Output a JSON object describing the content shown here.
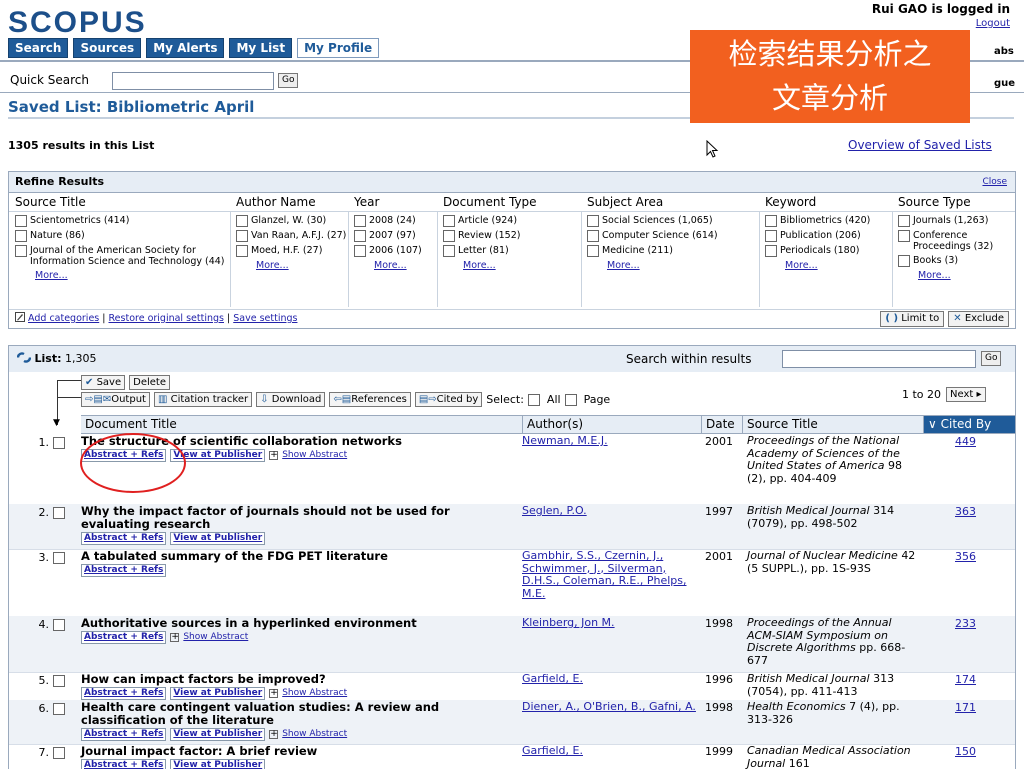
{
  "header": {
    "logo": "SCOPUS",
    "user": "Rui GAO is logged in",
    "logout": "Logout",
    "labs": "abs",
    "gue": "gue"
  },
  "nav": [
    "Search",
    "Sources",
    "My Alerts",
    "My List",
    "My Profile"
  ],
  "quick_search": {
    "label": "Quick Search",
    "value": "",
    "go": "Go"
  },
  "saved_list_title": "Saved List: Bibliometric April",
  "results_count": "1305 results in this List",
  "overview_link": "Overview of Saved Lists",
  "overlay": {
    "line1": "检索结果分析之",
    "line2": "文章分析"
  },
  "refine": {
    "title": "Refine Results",
    "close": "Close",
    "columns": [
      {
        "header": "Source Title",
        "items": [
          "Scientometrics (414)",
          "Nature (86)",
          "Journal of the American Society for Information Science and Technology (44)"
        ],
        "more": "More..."
      },
      {
        "header": "Author Name",
        "items": [
          "Glanzel, W. (30)",
          "Van Raan, A.F.J. (27)",
          "Moed, H.F. (27)"
        ],
        "more": "More..."
      },
      {
        "header": "Year",
        "items": [
          "2008 (24)",
          "2007 (97)",
          "2006 (107)"
        ],
        "more": "More..."
      },
      {
        "header": "Document Type",
        "items": [
          "Article (924)",
          "Review (152)",
          "Letter (81)"
        ],
        "more": "More..."
      },
      {
        "header": "Subject Area",
        "items": [
          "Social Sciences (1,065)",
          "Computer Science (614)",
          "Medicine (211)"
        ],
        "more": "More..."
      },
      {
        "header": "Keyword",
        "items": [
          "Bibliometrics (420)",
          "Publication (206)",
          "Periodicals (180)"
        ],
        "more": "More..."
      },
      {
        "header": "Source Type",
        "items": [
          "Journals (1,263)",
          "Conference Proceedings (32)",
          "Books (3)"
        ],
        "more": "More..."
      }
    ],
    "footer": {
      "add": "Add categories",
      "restore": "Restore original settings",
      "save": "Save settings",
      "limit": "Limit to",
      "exclude": "Exclude"
    }
  },
  "list": {
    "label": "List:",
    "count": "1,305",
    "search_within": "Search within results",
    "go": "Go",
    "save": "Save",
    "delete": "Delete",
    "output": "Output",
    "citation_tracker": "Citation tracker",
    "download": "Download",
    "references": "References",
    "cited_by": "Cited by",
    "select": "Select:",
    "all": "All",
    "page": "Page",
    "pager": "1 to 20",
    "next": "Next"
  },
  "columns": {
    "doc": "Document Title",
    "author": "Author(s)",
    "date": "Date",
    "source": "Source Title",
    "cited": "Cited By"
  },
  "rows": [
    {
      "num": "1.",
      "title": "The structure of scientific collaboration networks",
      "links": [
        "Abstract + Refs",
        "View at Publisher"
      ],
      "show_abstract": "Show Abstract",
      "authors": "Newman, M.E.J.",
      "date": "2001",
      "source": "Proceedings of the National Academy of Sciences of the United States of America",
      "pages": "98 (2), pp. 404-409",
      "cited": "449"
    },
    {
      "num": "2.",
      "title": "Why the impact factor of journals should not be used for evaluating research",
      "links": [
        "Abstract + Refs",
        "View at Publisher"
      ],
      "show_abstract": "",
      "authors": "Seglen, P.O.",
      "date": "1997",
      "source": "British Medical Journal",
      "pages": "314 (7079), pp. 498-502",
      "cited": "363"
    },
    {
      "num": "3.",
      "title": "A tabulated summary of the FDG PET literature",
      "links": [
        "Abstract + Refs"
      ],
      "show_abstract": "",
      "authors": "Gambhir, S.S., Czernin, J., Schwimmer, J., Silverman, D.H.S., Coleman, R.E., Phelps, M.E.",
      "date": "2001",
      "source": "Journal of Nuclear Medicine",
      "pages": "42 (5 SUPPL.), pp. 1S-93S",
      "cited": "356"
    },
    {
      "num": "4.",
      "title": "Authoritative sources in a hyperlinked environment",
      "links": [
        "Abstract + Refs"
      ],
      "show_abstract": "Show Abstract",
      "authors": "Kleinberg, Jon M.",
      "date": "1998",
      "source": "Proceedings of the Annual ACM-SIAM Symposium on Discrete Algorithms",
      "pages": "pp. 668-677",
      "cited": "233"
    },
    {
      "num": "5.",
      "title": "How can impact factors be improved?",
      "links": [
        "Abstract + Refs",
        "View at Publisher"
      ],
      "show_abstract": "Show Abstract",
      "authors": "Garfield, E.",
      "date": "1996",
      "source": "British Medical Journal",
      "pages": "313 (7054), pp. 411-413",
      "cited": "174"
    },
    {
      "num": "6.",
      "title": "Health care contingent valuation studies: A review and classification of the literature",
      "links": [
        "Abstract + Refs",
        "View at Publisher"
      ],
      "show_abstract": "Show Abstract",
      "authors": "Diener, A., O'Brien, B., Gafni, A.",
      "date": "1998",
      "source": "Health Economics",
      "pages": "7 (4), pp. 313-326",
      "cited": "171"
    },
    {
      "num": "7.",
      "title": "Journal impact factor: A brief review",
      "links": [
        "Abstract + Refs",
        "View at Publisher"
      ],
      "show_abstract": "",
      "authors": "Garfield, E.",
      "date": "1999",
      "source": "Canadian Medical Association Journal",
      "pages": "161",
      "cited": "150"
    }
  ]
}
